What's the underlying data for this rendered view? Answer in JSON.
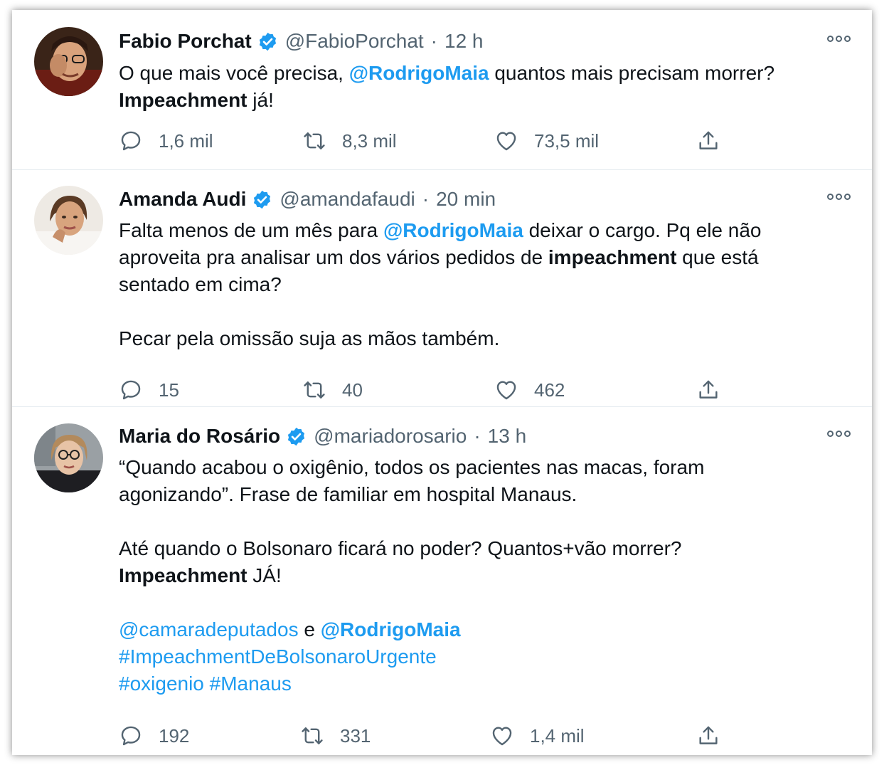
{
  "colors": {
    "link": "#1d9bf0",
    "verified": "#1d9bf0",
    "secondary_text": "#536471",
    "divider": "#e6ecf0"
  },
  "tweets": [
    {
      "author": {
        "name": "Fabio Porchat",
        "handle": "@FabioPorchat",
        "verified_icon": "verified-badge-icon",
        "avatar_icon": "avatar-photo"
      },
      "separator": "·",
      "time": "12 h",
      "text": {
        "l1a": "O que mais você precisa, ",
        "l1b": "@RodrigoMaia",
        "l1c": " quantos mais precisam morrer?",
        "l2a": "Impeachment",
        "l2b": " já!"
      },
      "stats": {
        "replies": "1,6 mil",
        "retweets": "8,3 mil",
        "likes": "73,5 mil"
      }
    },
    {
      "author": {
        "name": "Amanda Audi",
        "handle": "@amandafaudi",
        "verified_icon": "verified-badge-icon",
        "avatar_icon": "avatar-photo"
      },
      "separator": "·",
      "time": "20 min",
      "text": {
        "l1a": "Falta menos de um mês para ",
        "l1b": "@RodrigoMaia",
        "l1c": " deixar o cargo. Pq ele não",
        "l2a": "aproveita pra analisar um dos vários pedidos de ",
        "l2b": "impeachment",
        "l2c": " que está",
        "l3": "sentado em cima?",
        "l4": "Pecar pela omissão suja as mãos também."
      },
      "stats": {
        "replies": "15",
        "retweets": "40",
        "likes": "462"
      }
    },
    {
      "author": {
        "name": "Maria do Rosário",
        "handle": "@mariadorosario",
        "verified_icon": "verified-badge-icon",
        "avatar_icon": "avatar-photo"
      },
      "separator": "·",
      "time": "13 h",
      "text": {
        "l1": "“Quando acabou o oxigênio, todos os pacientes nas macas, foram",
        "l2": "agonizando”. Frase de familiar em hospital Manaus.",
        "l3": "Até quando o Bolsonaro ficará no poder? Quantos+vão morrer?",
        "l4a": "Impeachment",
        "l4b": " JÁ!",
        "l5a": "@camaradeputados",
        "l5b": " e ",
        "l5c": "@RodrigoMaia",
        "l6": "#ImpeachmentDeBolsonaroUrgente",
        "l7a": "#oxigenio",
        "l7b": " ",
        "l7c": "#Manaus"
      },
      "stats": {
        "replies": "192",
        "retweets": "331",
        "likes": "1,4 mil"
      }
    }
  ]
}
